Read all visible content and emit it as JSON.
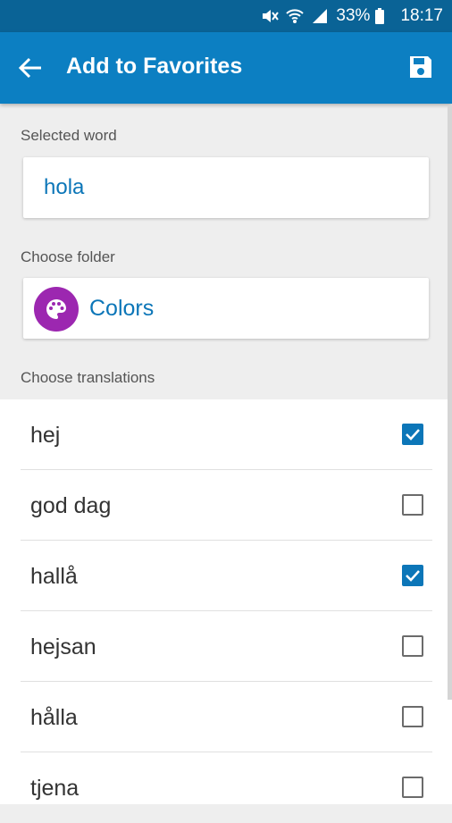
{
  "status_bar": {
    "battery": "33%",
    "time": "18:17",
    "icons": [
      "mute-icon",
      "wifi-icon",
      "signal-icon",
      "battery-icon"
    ]
  },
  "app_bar": {
    "title": "Add to Favorites",
    "back_icon": "arrow-back-icon",
    "save_icon": "save-floppy-icon"
  },
  "selected_word": {
    "label": "Selected word",
    "value": "hola"
  },
  "folder": {
    "label": "Choose folder",
    "value": "Colors",
    "icon": "palette-icon",
    "icon_color": "#9c27b0"
  },
  "translations": {
    "label": "Choose translations",
    "items": [
      {
        "text": "hej",
        "checked": true
      },
      {
        "text": "god dag",
        "checked": false
      },
      {
        "text": "hallå",
        "checked": true
      },
      {
        "text": "hejsan",
        "checked": false
      },
      {
        "text": "hålla",
        "checked": false
      },
      {
        "text": "tjena",
        "checked": false
      }
    ]
  },
  "colors": {
    "app_bar": "#0c7fc2",
    "status_bar": "#0a6396",
    "accent": "#0c76b8"
  }
}
